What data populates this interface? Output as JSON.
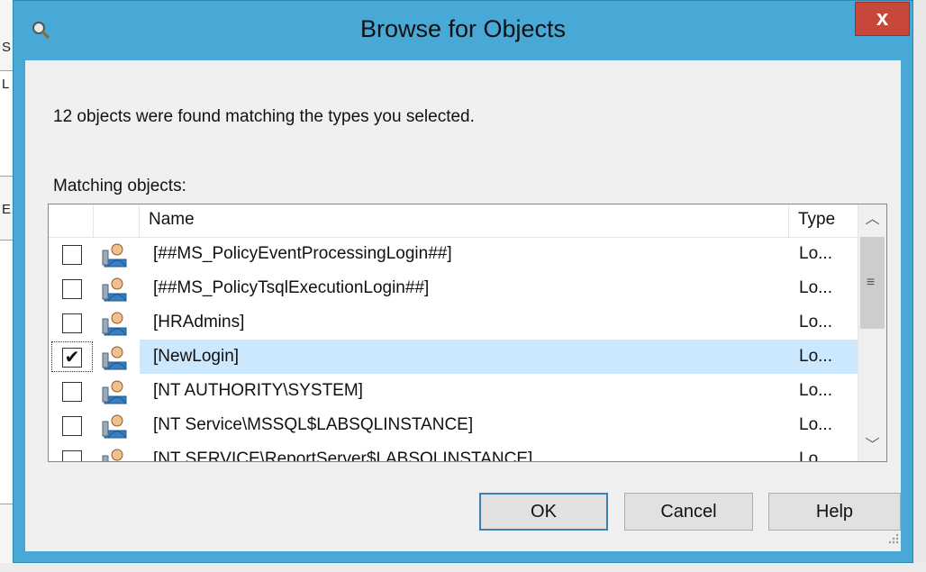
{
  "dialog": {
    "title": "Browse for Objects",
    "close_label": "x",
    "info_text": "12 objects were found matching the types you selected.",
    "matching_label": "Matching objects:"
  },
  "columns": {
    "name": "Name",
    "type": "Type"
  },
  "rows": [
    {
      "name": "[##MS_PolicyEventProcessingLogin##]",
      "type": "Lo...",
      "checked": false
    },
    {
      "name": "[##MS_PolicyTsqlExecutionLogin##]",
      "type": "Lo...",
      "checked": false
    },
    {
      "name": "[HRAdmins]",
      "type": "Lo...",
      "checked": false
    },
    {
      "name": "[NewLogin]",
      "type": "Lo...",
      "checked": true
    },
    {
      "name": "[NT AUTHORITY\\SYSTEM]",
      "type": "Lo...",
      "checked": false
    },
    {
      "name": "[NT Service\\MSSQL$LABSQLINSTANCE]",
      "type": "Lo...",
      "checked": false
    },
    {
      "name": "[NT SERVICE\\ReportServer$LABSQLINSTANCE]",
      "type": "Lo...",
      "checked": false
    }
  ],
  "check_mark": "✔",
  "buttons": {
    "ok": "OK",
    "cancel": "Cancel",
    "help": "Help"
  },
  "scrollbar": {
    "up": "︿",
    "down": "﹀",
    "grip": "≡"
  },
  "background": {
    "letters": [
      "S",
      "L",
      "E"
    ]
  },
  "colors": {
    "frame": "#48a9d6",
    "close": "#c7483a",
    "selection": "#cce8ff"
  }
}
